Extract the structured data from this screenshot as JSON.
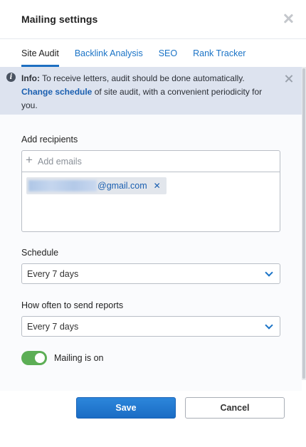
{
  "dialog": {
    "title": "Mailing settings"
  },
  "tabs": [
    {
      "label": "Site Audit",
      "active": true
    },
    {
      "label": "Backlink Analysis",
      "active": false
    },
    {
      "label": "SEO",
      "active": false
    },
    {
      "label": "Rank Tracker",
      "active": false
    }
  ],
  "info": {
    "prefix": "Info:",
    "text1": " To receive letters, audit should be done automatically.",
    "link": "Change schedule",
    "text2": " of site audit, with a convenient periodicity for you."
  },
  "recipients": {
    "label": "Add recipients",
    "placeholder": "Add emails",
    "chips": [
      {
        "domain": "@gmail.com"
      }
    ]
  },
  "schedule": {
    "label": "Schedule",
    "value": "Every 7 days"
  },
  "reports": {
    "label": "How often to send reports",
    "value": "Every 7 days"
  },
  "mailing": {
    "label": "Mailing is on",
    "on": true
  },
  "buttons": {
    "save": "Save",
    "cancel": "Cancel"
  },
  "colors": {
    "accent": "#1a73c6",
    "toggle_on": "#5cae55",
    "info_bg": "#dde3ef"
  }
}
